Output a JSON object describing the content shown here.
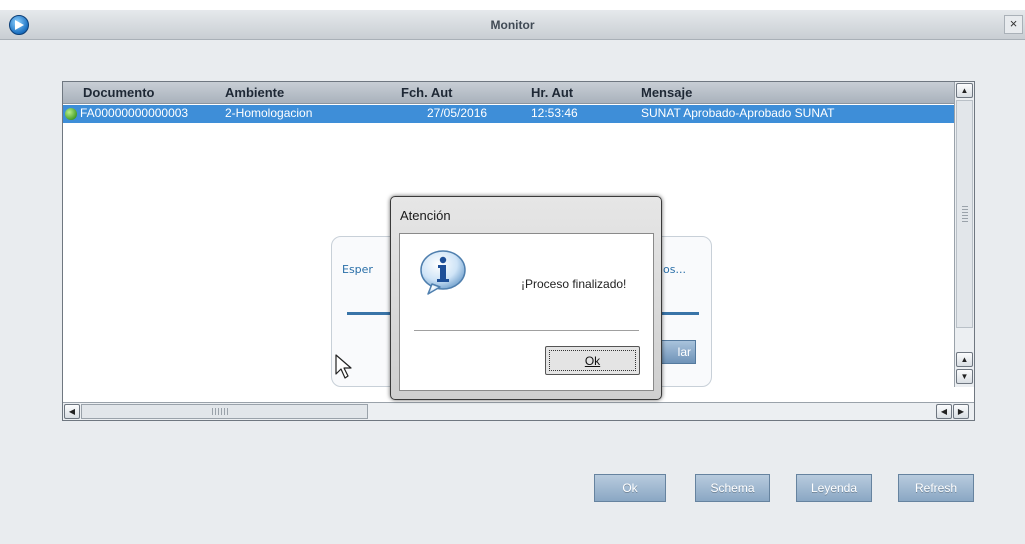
{
  "window": {
    "title": "Monitor",
    "close_glyph": "×"
  },
  "grid": {
    "columns": [
      "Documento",
      "Ambiente",
      "Fch. Aut",
      "Hr. Aut",
      "Mensaje"
    ],
    "rows": [
      {
        "status_icon": "green-status-icon",
        "documento": "FA00000000000003",
        "ambiente": "2-Homologacion",
        "fch_aut": "27/05/2016",
        "hr_aut": "12:53:46",
        "mensaje": "SUNAT Aprobado-Aprobado SUNAT"
      }
    ]
  },
  "progress_panel": {
    "text_start": "Esper",
    "text_end": "os...",
    "cancel_label": "lar"
  },
  "dialog": {
    "title": "Atención",
    "message": "¡Proceso finalizado!",
    "ok_label": "Ok",
    "icon": "info-icon"
  },
  "actions": {
    "ok": "Ok",
    "schema": "Schema",
    "leyenda": "Leyenda",
    "refresh": "Refresh"
  },
  "colors": {
    "selection": "#3e8ed8",
    "button": "#8aa7c4",
    "status_ok": "#3f9a22"
  }
}
